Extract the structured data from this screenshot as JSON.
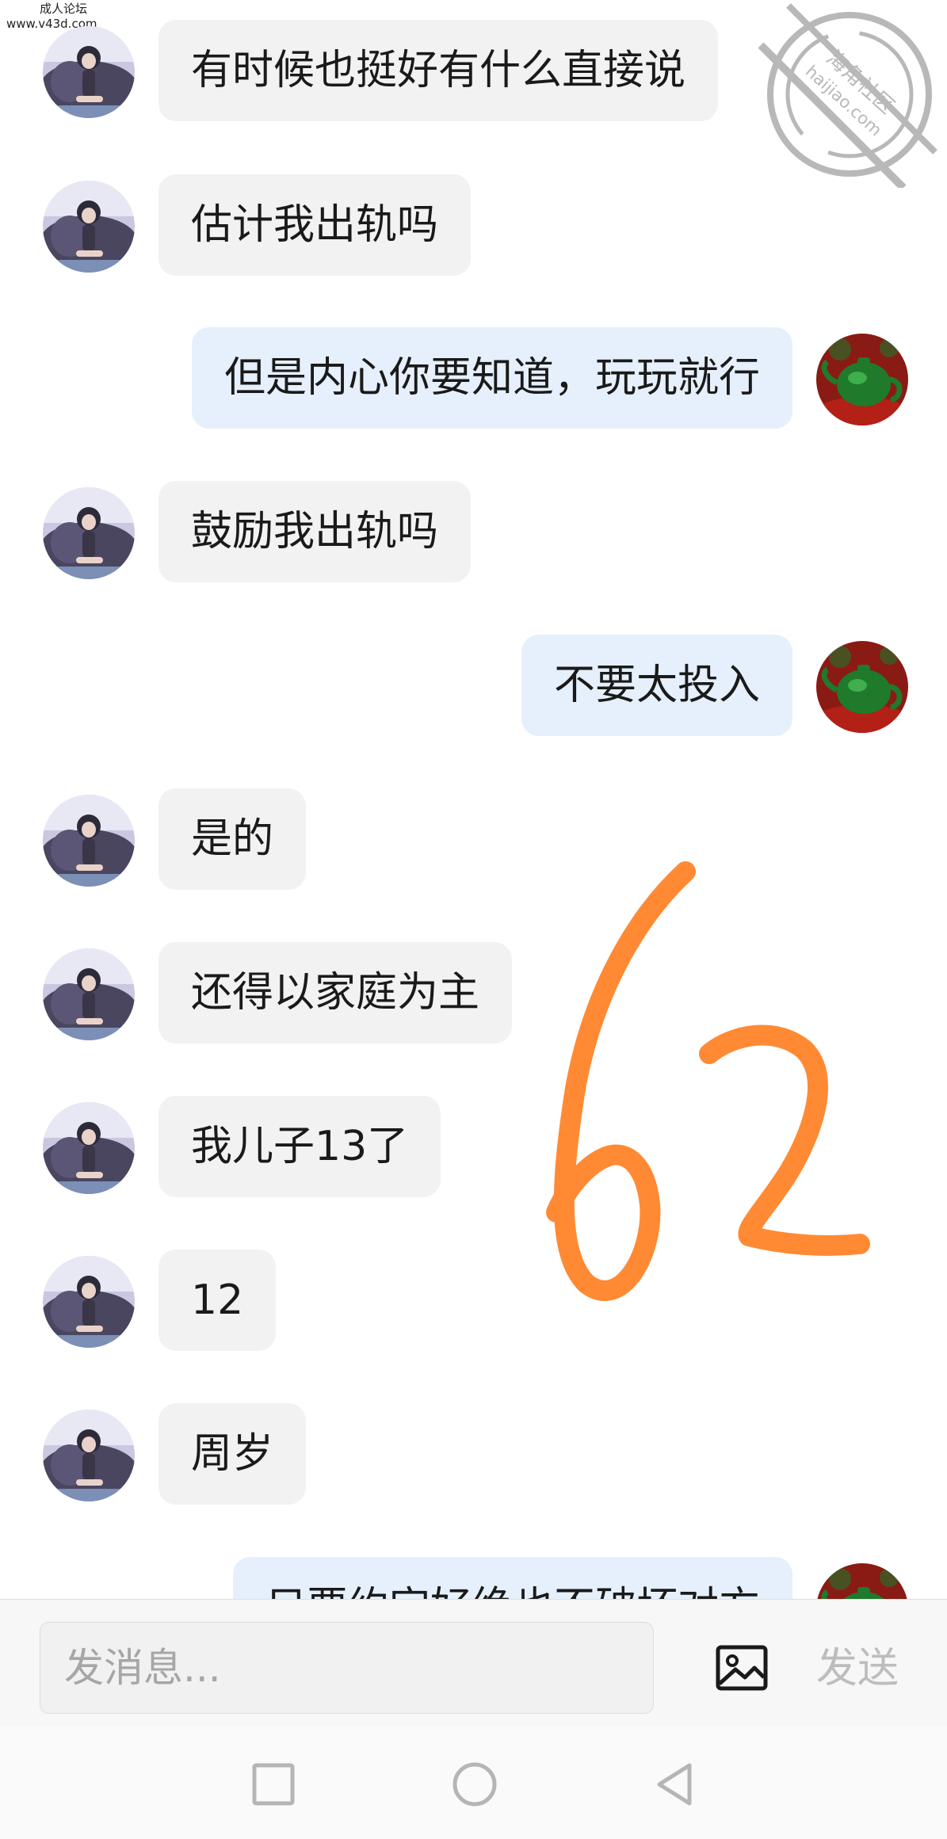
{
  "watermark": {
    "line1": "成人论坛",
    "line2": "www.v43d.com"
  },
  "stamp": {
    "text_top": "海角社区",
    "text_url": "haijiao.com"
  },
  "messages": [
    {
      "side": "in",
      "text": "有时候也挺好有什么直接说"
    },
    {
      "side": "in",
      "text": "估计我出轨吗"
    },
    {
      "side": "out",
      "text": "但是内心你要知道，玩玩就行"
    },
    {
      "side": "in",
      "text": "鼓励我出轨吗"
    },
    {
      "side": "out",
      "text": "不要太投入"
    },
    {
      "side": "in",
      "text": "是的"
    },
    {
      "side": "in",
      "text": "还得以家庭为主"
    },
    {
      "side": "in",
      "text": "我儿子13了"
    },
    {
      "side": "in",
      "text": "12"
    },
    {
      "side": "in",
      "text": "周岁"
    },
    {
      "side": "out",
      "text": "只要约定好绝也不破坏对方"
    }
  ],
  "handwriting": {
    "text": "62",
    "color": "#ff8a33"
  },
  "input": {
    "placeholder": "发消息..."
  },
  "actions": {
    "image_icon": "image-icon",
    "send_label": "发送"
  },
  "navbar": {
    "icons": [
      "recent-apps-icon",
      "home-icon",
      "back-icon"
    ]
  },
  "colors": {
    "incoming_bubble": "#f2f2f2",
    "outgoing_bubble": "#e6f0fc",
    "send_disabled": "#bdbdbd"
  }
}
